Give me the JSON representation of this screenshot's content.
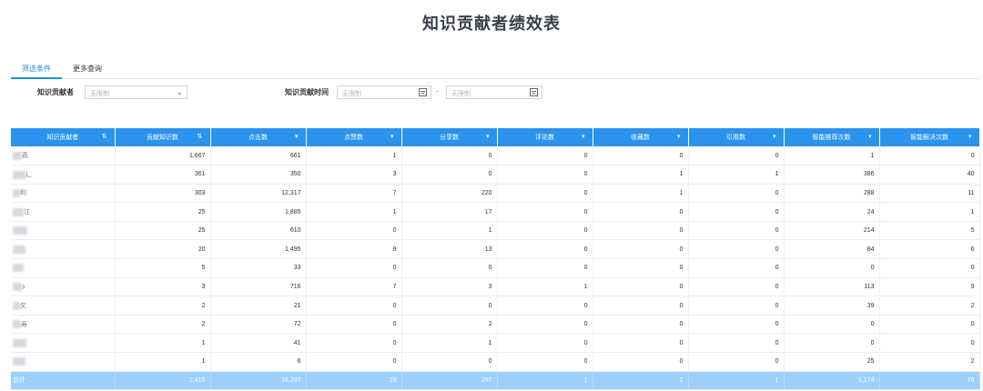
{
  "page": {
    "title": "知识贡献者绩效表"
  },
  "tabs": [
    {
      "label": "筛选条件",
      "active": true
    },
    {
      "label": "更多查询",
      "active": false
    }
  ],
  "filters": {
    "contributor_label": "知识贡献者",
    "contributor_placeholder": "无限制",
    "time_label": "知识贡献时间",
    "start_placeholder": "无限制",
    "separator": "-",
    "end_placeholder": "无限制"
  },
  "table": {
    "headers": [
      "知识贡献者",
      "贡献知识数",
      "点击数",
      "点赞数",
      "分享数",
      "评论数",
      "收藏数",
      "引用数",
      "智能推荐次数",
      "智能解决次数"
    ],
    "header_icons": [
      "sort-icon",
      "sort-icon",
      "dropdown-icon",
      "dropdown-icon",
      "dropdown-icon",
      "dropdown-icon",
      "dropdown-icon",
      "dropdown-icon",
      "dropdown-icon",
      "dropdown-icon"
    ],
    "rows": [
      {
        "name": "荔",
        "values": [
          "1,667",
          "661",
          "1",
          "0",
          "0",
          "0",
          "0",
          "1",
          "0"
        ]
      },
      {
        "name": "辶",
        "values": [
          "361",
          "350",
          "3",
          "0",
          "0",
          "1",
          "1",
          "386",
          "40"
        ]
      },
      {
        "name": "利",
        "values": [
          "303",
          "12,317",
          "7",
          "220",
          "0",
          "1",
          "0",
          "288",
          "11"
        ]
      },
      {
        "name": "江",
        "values": [
          "25",
          "1,885",
          "1",
          "17",
          "0",
          "0",
          "0",
          "24",
          "1"
        ]
      },
      {
        "name": "",
        "values": [
          "25",
          "610",
          "0",
          "1",
          "0",
          "0",
          "0",
          "214",
          "5"
        ]
      },
      {
        "name": "",
        "values": [
          "20",
          "1,495",
          "9",
          "13",
          "0",
          "0",
          "0",
          "84",
          "6"
        ]
      },
      {
        "name": "",
        "values": [
          "5",
          "33",
          "0",
          "0",
          "0",
          "0",
          "0",
          "0",
          "0"
        ]
      },
      {
        "name": "з",
        "values": [
          "3",
          "716",
          "7",
          "3",
          "1",
          "0",
          "0",
          "113",
          "9"
        ]
      },
      {
        "name": "攵",
        "values": [
          "2",
          "21",
          "0",
          "0",
          "0",
          "0",
          "0",
          "39",
          "2"
        ]
      },
      {
        "name": "寿",
        "values": [
          "2",
          "72",
          "0",
          "2",
          "0",
          "0",
          "0",
          "0",
          "0"
        ]
      },
      {
        "name": "",
        "values": [
          "1",
          "41",
          "0",
          "1",
          "0",
          "0",
          "0",
          "0",
          "0"
        ]
      },
      {
        "name": "",
        "values": [
          "1",
          "6",
          "0",
          "0",
          "0",
          "0",
          "0",
          "25",
          "2"
        ]
      }
    ],
    "total": {
      "label": "合计",
      "values": [
        "2,415",
        "18,207",
        "28",
        "257",
        "1",
        "2",
        "1",
        "1,174",
        "76"
      ]
    }
  },
  "colors": {
    "header_bg": "#2a93ee",
    "total_bg": "#9dd0fb",
    "accent": "#2a8be0"
  }
}
